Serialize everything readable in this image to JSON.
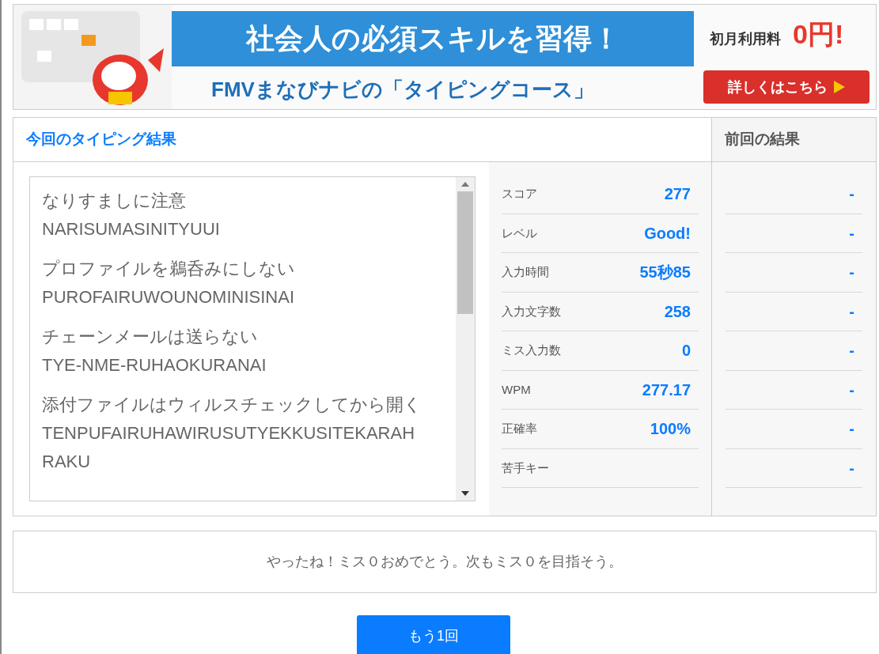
{
  "banner": {
    "headline": "社会人の必須スキルを習得！",
    "subline": "FMVまなびナビの「タイピングコース」",
    "price_label": "初月利用料",
    "price": "0円!",
    "cta": "詳しくはこちら"
  },
  "results": {
    "current_title": "今回のタイピング結果",
    "previous_title": "前回の結果",
    "phrases": [
      {
        "text": "なりすましに注意",
        "romaji": [
          "NARISUMASINITYUUI"
        ]
      },
      {
        "text": "プロファイルを鵜呑みにしない",
        "romaji": [
          "PUROFAIRUWOUNOMINISINAI"
        ]
      },
      {
        "text": "チェーンメールは送らない",
        "romaji": [
          "TYE-NME-RUHAOKURANAI"
        ]
      },
      {
        "text": "添付ファイルはウィルスチェックしてから開く",
        "romaji": [
          "TENPUFAIRUHAWIRUSUTYEKKUSITEKARAH",
          "RAKU"
        ]
      }
    ],
    "stats": [
      {
        "label": "スコア",
        "value": "277",
        "previous": "-"
      },
      {
        "label": "レベル",
        "value": "Good!",
        "previous": "-"
      },
      {
        "label": "入力時間",
        "value": "55秒85",
        "previous": "-"
      },
      {
        "label": "入力文字数",
        "value": "258",
        "previous": "-"
      },
      {
        "label": "ミス入力数",
        "value": "0",
        "previous": "-"
      },
      {
        "label": "WPM",
        "value": "277.17",
        "previous": "-"
      },
      {
        "label": "正確率",
        "value": "100%",
        "previous": "-"
      },
      {
        "label": "苦手キー",
        "previous": "-"
      }
    ]
  },
  "message": "やったね！ミス０おめでとう。次もミス０を目指そう。",
  "retry_button": "もう1回"
}
